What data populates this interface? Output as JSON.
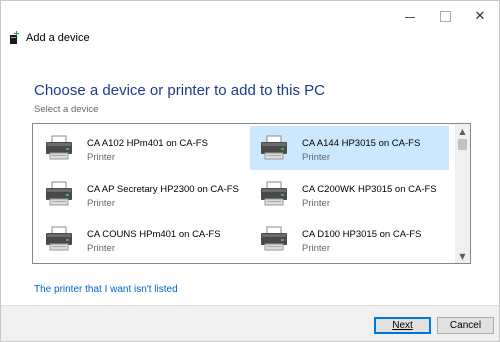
{
  "window": {
    "title": "Add a device",
    "controls": {
      "minimize_icon": "minimize-icon",
      "maximize_icon": "maximize-icon",
      "close_glyph": "✕"
    }
  },
  "main": {
    "title": "Choose a device or printer to add to this PC",
    "subtitle": "Select a device"
  },
  "devices": [
    {
      "name": "CA A102 HPm401 on CA-FS",
      "type": "Printer",
      "icon": "printer-icon",
      "selected": false
    },
    {
      "name": "CA A144 HP3015 on CA-FS",
      "type": "Printer",
      "icon": "printer-icon",
      "selected": true
    },
    {
      "name": "CA AP Secretary HP2300 on CA-FS",
      "type": "Printer",
      "icon": "printer-icon",
      "selected": false
    },
    {
      "name": "CA C200WK HP3015 on CA-FS",
      "type": "Printer",
      "icon": "printer-icon",
      "selected": false
    },
    {
      "name": "CA COUNS HPm401 on CA-FS",
      "type": "Printer",
      "icon": "printer-icon",
      "selected": false
    },
    {
      "name": "CA D100 HP3015 on CA-FS",
      "type": "Printer",
      "icon": "printer-icon",
      "selected": false
    }
  ],
  "colors": {
    "selected_bg": "#cce8ff",
    "title": "#1e3a8c",
    "link": "#0066cc",
    "focus_border": "#0078d7"
  },
  "link_text": "The printer that I want isn't listed",
  "buttons": {
    "next": "Next",
    "cancel": "Cancel"
  }
}
